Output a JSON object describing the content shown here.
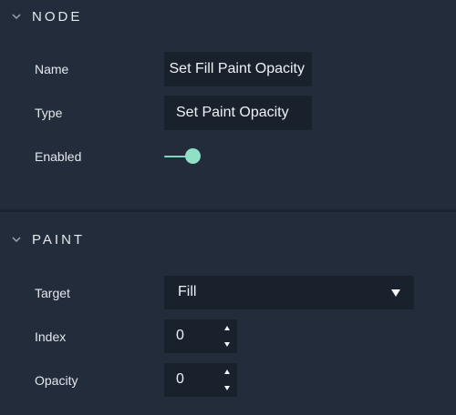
{
  "node_section": {
    "title": "NODE",
    "chevron_icon": "chevron-down-icon",
    "name_label": "Name",
    "name_value": "Set Fill Paint Opacity",
    "type_label": "Type",
    "type_value": "Set Paint Opacity",
    "enabled_label": "Enabled",
    "enabled_value": true
  },
  "paint_section": {
    "title": "PAINT",
    "chevron_icon": "chevron-down-icon",
    "target_label": "Target",
    "target_value": "Fill",
    "index_label": "Index",
    "index_value": "0",
    "opacity_label": "Opacity",
    "opacity_value": "0"
  },
  "colors": {
    "background": "#232c3b",
    "field_background": "#19212d",
    "accent": "#8fe0c4",
    "text": "#e4e8ee"
  }
}
